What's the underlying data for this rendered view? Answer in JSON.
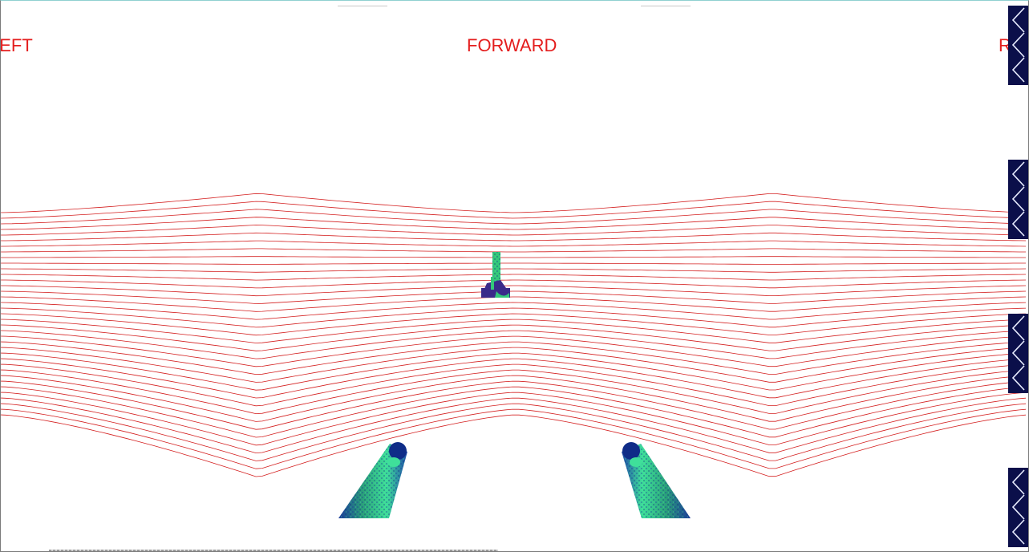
{
  "view": {
    "labels": {
      "left": "LEFT",
      "forward": "FORWARD",
      "right": "RIGHT"
    },
    "label_color": "#e41e1e",
    "grid_color": "#d42020",
    "terrain_line_count": 37
  },
  "side_buttons": [
    {
      "name": "side-button-1",
      "icon": "chevron-left-icon"
    },
    {
      "name": "side-button-2",
      "icon": "chevron-left-icon"
    },
    {
      "name": "side-button-3",
      "icon": "chevron-left-icon"
    },
    {
      "name": "side-button-4",
      "icon": "chevron-left-icon"
    }
  ],
  "colors": {
    "button_bg": "#0b0f4a",
    "button_icon": "#e8ecff",
    "barrel_light": "#3dd28a",
    "barrel_dark": "#1a3a9a",
    "target_green": "#34c77a",
    "target_purple": "#3a2a8a"
  }
}
